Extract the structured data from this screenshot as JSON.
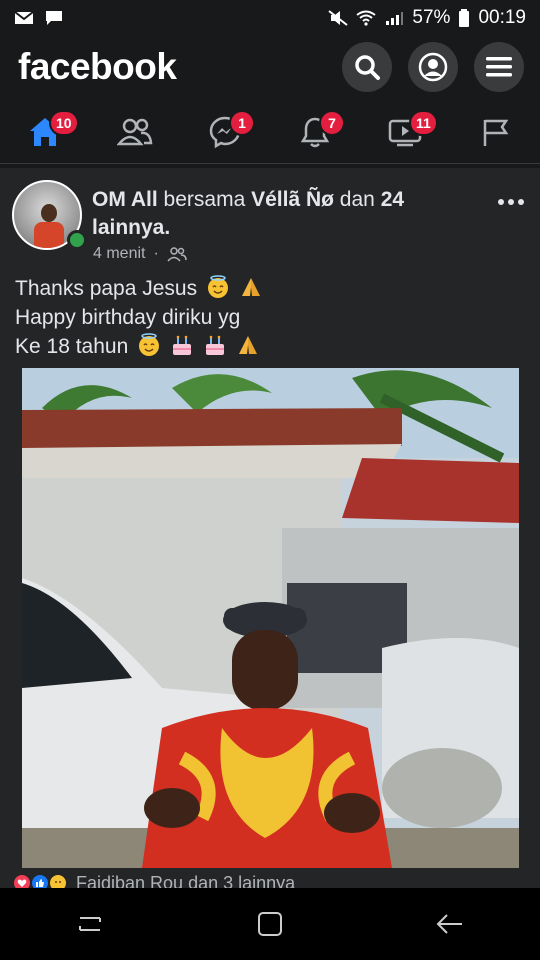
{
  "status_bar": {
    "battery": "57%",
    "time": "00:19"
  },
  "header": {
    "logo": "facebook",
    "icons": [
      "search-icon",
      "profile-icon",
      "menu-icon"
    ]
  },
  "nav": {
    "items": [
      {
        "name": "home-icon",
        "badge": "10",
        "active": true
      },
      {
        "name": "friends-icon",
        "badge": ""
      },
      {
        "name": "messenger-icon",
        "badge": "1"
      },
      {
        "name": "notifications-icon",
        "badge": "7"
      },
      {
        "name": "watch-icon",
        "badge": "11"
      },
      {
        "name": "pages-flag-icon",
        "badge": ""
      }
    ],
    "accent": "#2d88ff",
    "badge_color": "#e41e3f"
  },
  "post": {
    "author_name": "OM All",
    "with_text": " bersama ",
    "tagged_name": "Véllã Ñø",
    "and_text": " dan ",
    "others_count": "24",
    "others_text": "lainnya.",
    "time": "4 menit",
    "separator": "·",
    "audience_icon": "friends-audience-icon",
    "text_lines": [
      "Thanks papa Jesus",
      "Happy birthday diriku yg",
      "Ke 18 tahun"
    ],
    "reactions_text": "Faidiban Rou dan 3 lainnya"
  },
  "system_nav": {
    "icons": [
      "recent-apps-icon",
      "home-button-icon",
      "back-icon"
    ]
  }
}
